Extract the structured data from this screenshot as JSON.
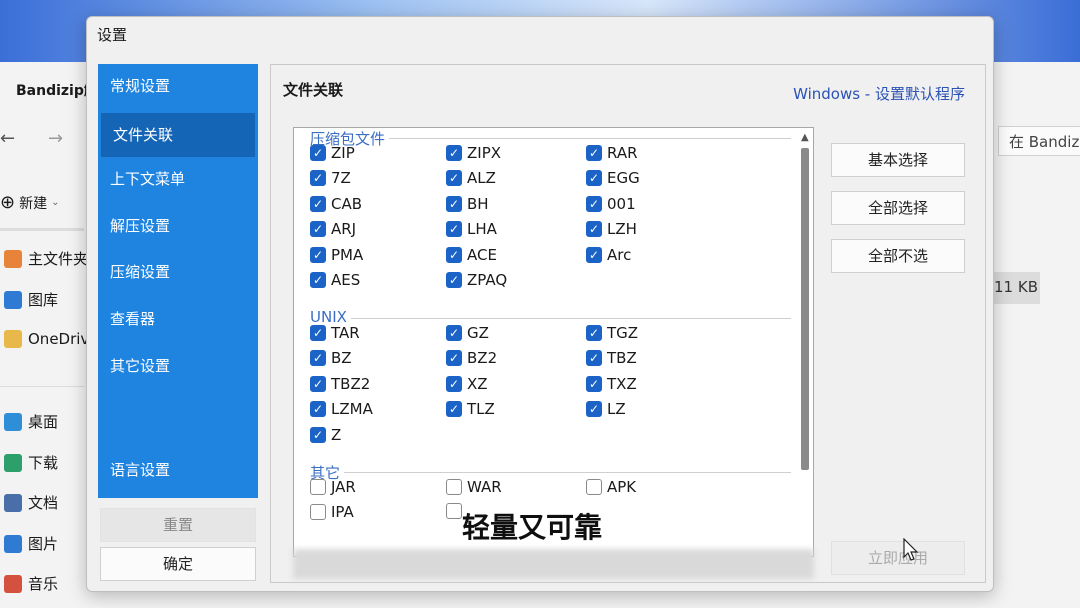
{
  "background_window": {
    "title": "Bandizip解",
    "new_label": "新建",
    "search_placeholder": "在 Bandizi",
    "file_size": "11 KB",
    "sidebar": [
      {
        "label": "主文件夹",
        "icon": "home-icon"
      },
      {
        "label": "图库",
        "icon": "gallery-icon"
      },
      {
        "label": "OneDriv",
        "icon": "folder-icon"
      },
      {
        "label": "桌面",
        "icon": "desktop-icon"
      },
      {
        "label": "下载",
        "icon": "download-icon"
      },
      {
        "label": "文档",
        "icon": "document-icon"
      },
      {
        "label": "图片",
        "icon": "picture-icon"
      },
      {
        "label": "音乐",
        "icon": "music-icon"
      }
    ]
  },
  "dialog": {
    "title": "设置",
    "nav": [
      {
        "label": "常规设置",
        "active": false
      },
      {
        "label": "文件关联",
        "active": true
      },
      {
        "label": "上下文菜单",
        "active": false
      },
      {
        "label": "解压设置",
        "active": false
      },
      {
        "label": "压缩设置",
        "active": false
      },
      {
        "label": "查看器",
        "active": false
      },
      {
        "label": "其它设置",
        "active": false
      },
      {
        "label": "语言设置",
        "active": false
      }
    ],
    "reset_button": "重置",
    "ok_button": "确定",
    "section_title": "文件关联",
    "windows_link": "Windows - 设置默认程序",
    "groups": [
      {
        "title": "压缩包文件",
        "items": [
          {
            "label": "ZIP",
            "checked": true
          },
          {
            "label": "ZIPX",
            "checked": true
          },
          {
            "label": "RAR",
            "checked": true
          },
          {
            "label": "7Z",
            "checked": true
          },
          {
            "label": "ALZ",
            "checked": true
          },
          {
            "label": "EGG",
            "checked": true
          },
          {
            "label": "CAB",
            "checked": true
          },
          {
            "label": "BH",
            "checked": true
          },
          {
            "label": "001",
            "checked": true
          },
          {
            "label": "ARJ",
            "checked": true
          },
          {
            "label": "LHA",
            "checked": true
          },
          {
            "label": "LZH",
            "checked": true
          },
          {
            "label": "PMA",
            "checked": true
          },
          {
            "label": "ACE",
            "checked": true
          },
          {
            "label": "Arc",
            "checked": true
          },
          {
            "label": "AES",
            "checked": true
          },
          {
            "label": "ZPAQ",
            "checked": true
          }
        ]
      },
      {
        "title": "UNIX",
        "items": [
          {
            "label": "TAR",
            "checked": true
          },
          {
            "label": "GZ",
            "checked": true
          },
          {
            "label": "TGZ",
            "checked": true
          },
          {
            "label": "BZ",
            "checked": true
          },
          {
            "label": "BZ2",
            "checked": true
          },
          {
            "label": "TBZ",
            "checked": true
          },
          {
            "label": "TBZ2",
            "checked": true
          },
          {
            "label": "XZ",
            "checked": true
          },
          {
            "label": "TXZ",
            "checked": true
          },
          {
            "label": "LZMA",
            "checked": true
          },
          {
            "label": "TLZ",
            "checked": true
          },
          {
            "label": "LZ",
            "checked": true
          },
          {
            "label": "Z",
            "checked": true
          }
        ]
      },
      {
        "title": "其它",
        "items": [
          {
            "label": "JAR",
            "checked": false
          },
          {
            "label": "WAR",
            "checked": false
          },
          {
            "label": "APK",
            "checked": false
          },
          {
            "label": "IPA",
            "checked": false
          },
          {
            "label": "",
            "checked": false
          }
        ]
      }
    ],
    "side_buttons": {
      "basic": "基本选择",
      "select_all": "全部选择",
      "select_none": "全部不选",
      "apply": "立即应用"
    }
  },
  "subtitle_caption": "轻量又可靠",
  "colors": {
    "nav_bg": "#1f84e0",
    "nav_active": "#1565b6",
    "checkbox_on": "#1b63c6",
    "link": "#2b52b4",
    "group_title": "#3a6ec4"
  }
}
